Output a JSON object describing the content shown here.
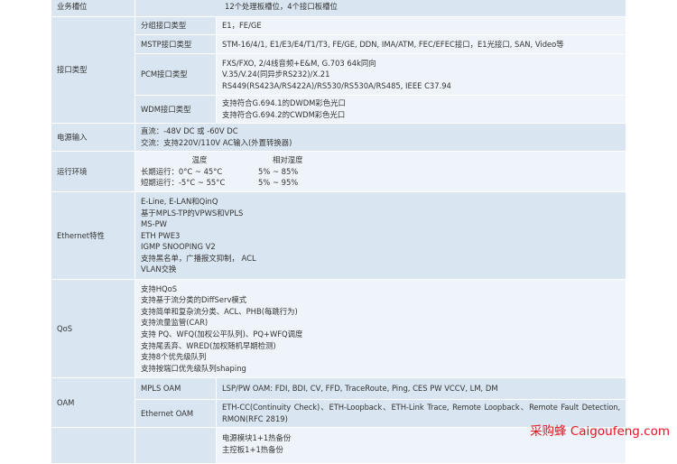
{
  "rows": {
    "slots": {
      "label": "业务槽位",
      "value": "12个处理板槽位，4个接口板槽位"
    },
    "interface": {
      "label": "接口类型",
      "group": {
        "label": "分组接口类型",
        "value": "E1，FE/GE"
      },
      "mstp": {
        "label": "MSTP接口类型",
        "value": "STM-16/4/1, E1/E3/E4/T1/T3, FE/GE, DDN, IMA/ATM, FEC/EFEC接口，E1光接口, SAN, Video等"
      },
      "pcm": {
        "label": "PCM接口类型",
        "lines": [
          "FXS/FXO, 2/4线音频+E&M, G.703 64k同向",
          "V.35/V.24(同异步RS232)/X.21",
          "RS449(RS423A/RS422A)/RS530/RS530A/RS485, IEEE C37.94"
        ]
      },
      "wdm": {
        "label": "WDM接口类型",
        "lines": [
          "支持符合G.694.1的DWDM彩色光口",
          "支持符合G.694.2的CWDM彩色光口"
        ]
      }
    },
    "power": {
      "label": "电源输入",
      "lines": [
        "直流：-48V DC 或 -60V DC",
        "交流：支持220V/110V AC输入(外置转换器)"
      ]
    },
    "env": {
      "label": "运行环境",
      "header": {
        "temp": "温度",
        "humidity": "相对湿度"
      },
      "long": {
        "temp": "长期运行：0°C ~ 45°C",
        "humidity": "5% ~ 85%"
      },
      "short": {
        "temp": "短期运行：-5°C ~ 55°C",
        "humidity": "5% ~ 95%"
      }
    },
    "ethernet": {
      "label": "Ethernet特性",
      "lines": [
        "E-Line, E-LAN和QinQ",
        "基于MPLS-TP的VPWS和VPLS",
        "MS-PW",
        "ETH PWE3",
        "IGMP SNOOPING V2",
        "支持黑名单，广播报文抑制， ACL",
        "VLAN交换"
      ]
    },
    "qos": {
      "label": "QoS",
      "lines": [
        "支持HQoS",
        "支持基于流分类的DiffServ模式",
        "支持简单和复杂流分类、ACL、PHB(每跳行为)",
        "支持流量监管(CAR)",
        "支持 PQ、WFQ(加权公平队列)、PQ+WFQ调度",
        "支持尾丢弃、WRED(加权随机早期检测)",
        "支持8个优先级队列",
        "支持按端口优先级队列shaping"
      ]
    },
    "oam": {
      "label": "OAM",
      "mpls": {
        "label": "MPLS OAM",
        "value": "LSP/PW OAM: FDI, BDI, CV, FFD, TraceRoute, Ping, CES PW VCCV, LM, DM"
      },
      "eth": {
        "label": "Ethernet OAM",
        "lines": [
          "ETH-CC(Continuity Check)、ETH-Loopback、ETH-Link Trace, Remote Loopback、Remote Fault Detection,",
          "RMON(RFC 2819)"
        ]
      }
    },
    "protection": {
      "lines": [
        "电源模块1+1热备份",
        "主控板1+1热备份"
      ]
    }
  },
  "watermark": "采购蜂 Caigoufeng.com"
}
